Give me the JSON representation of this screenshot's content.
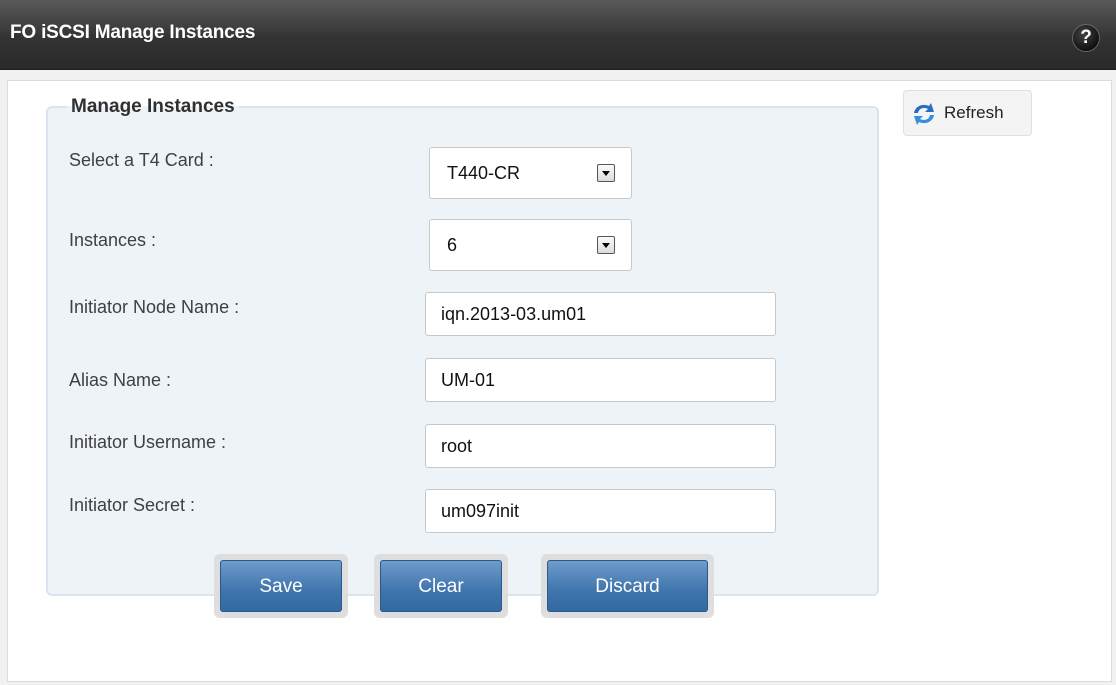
{
  "header": {
    "title": "FO iSCSI Manage Instances",
    "help_label": "?"
  },
  "toolbar": {
    "refresh_label": "Refresh",
    "refresh_icon": "refresh-icon"
  },
  "form": {
    "legend": "Manage Instances",
    "card": {
      "label": "Select a T4 Card :",
      "value": "T440-CR"
    },
    "instances": {
      "label": "Instances :",
      "value": "6"
    },
    "node_name": {
      "label": "Initiator Node Name :",
      "value": "iqn.2013-03.um01"
    },
    "alias": {
      "label": "Alias Name :",
      "value": "UM-01"
    },
    "username": {
      "label": "Initiator Username :",
      "value": "root"
    },
    "secret": {
      "label": "Initiator Secret :",
      "value": "um097init"
    }
  },
  "actions": {
    "save": "Save",
    "clear": "Clear",
    "discard": "Discard"
  },
  "colors": {
    "titlebar": "#333333",
    "button": "#3f74ad",
    "panel": "#eef3f8"
  }
}
